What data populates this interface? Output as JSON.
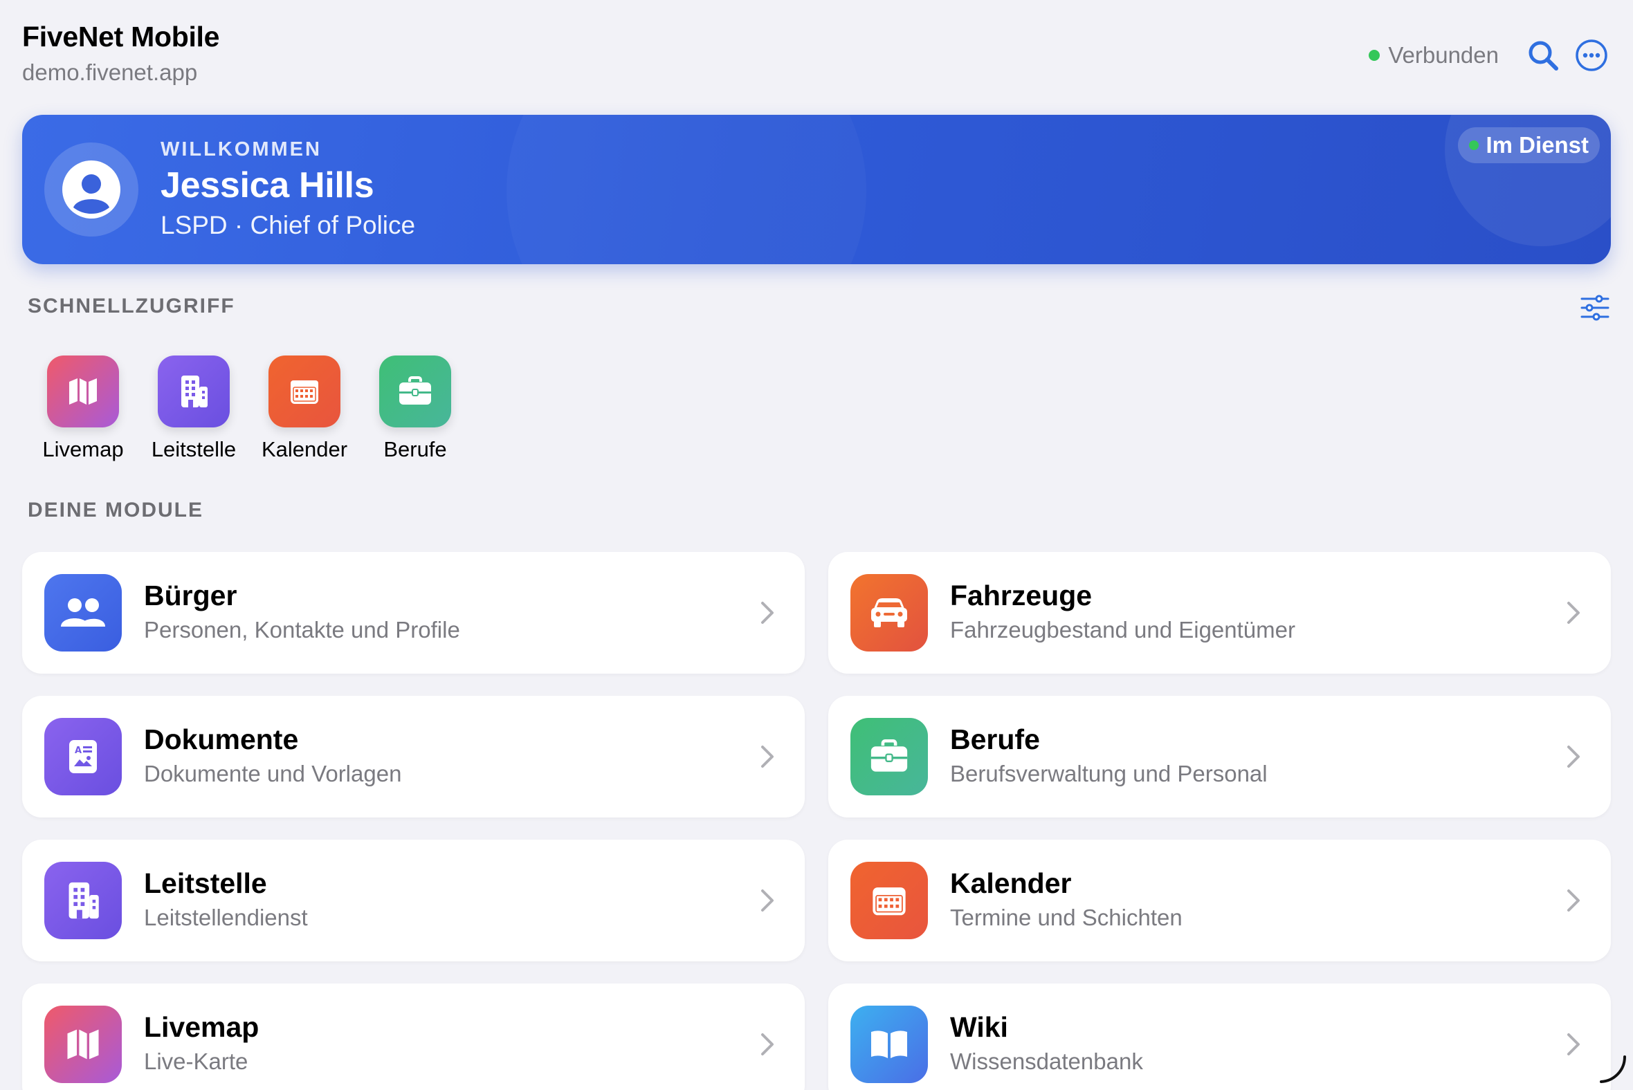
{
  "header": {
    "title": "FiveNet Mobile",
    "subtitle": "demo.fivenet.app",
    "status_text": "Verbunden",
    "status_color": "#34c759",
    "search_icon": "search-icon",
    "more_icon": "more-icon"
  },
  "welcome": {
    "label": "WILLKOMMEN",
    "name": "Jessica Hills",
    "role": "LSPD · Chief of Police",
    "duty_status": "Im Dienst",
    "avatar_icon": "person-icon"
  },
  "quick_access": {
    "title": "SCHNELLZUGRIFF",
    "filter_icon": "sliders-icon",
    "items": [
      {
        "label": "Livemap",
        "icon": "map-icon"
      },
      {
        "label": "Leitstelle",
        "icon": "building-icon"
      },
      {
        "label": "Kalender",
        "icon": "calendar-icon"
      },
      {
        "label": "Berufe",
        "icon": "briefcase-icon"
      }
    ]
  },
  "modules": {
    "title": "DEINE MODULE",
    "items": [
      {
        "title": "Bürger",
        "subtitle": "Personen, Kontakte und Profile",
        "icon": "people-icon"
      },
      {
        "title": "Fahrzeuge",
        "subtitle": "Fahrzeugbestand und Eigentümer",
        "icon": "car-icon"
      },
      {
        "title": "Dokumente",
        "subtitle": "Dokumente und Vorlagen",
        "icon": "document-icon"
      },
      {
        "title": "Berufe",
        "subtitle": "Berufsverwaltung und Personal",
        "icon": "briefcase-icon"
      },
      {
        "title": "Leitstelle",
        "subtitle": "Leitstellendienst",
        "icon": "building-icon"
      },
      {
        "title": "Kalender",
        "subtitle": "Termine und Schichten",
        "icon": "calendar-icon"
      },
      {
        "title": "Livemap",
        "subtitle": "Live-Karte",
        "icon": "map-icon"
      },
      {
        "title": "Wiki",
        "subtitle": "Wissensdatenbank",
        "icon": "book-icon"
      }
    ]
  },
  "colors": {
    "accent": "#2f5bd8",
    "background": "#f2f2f7",
    "online": "#34c759"
  }
}
